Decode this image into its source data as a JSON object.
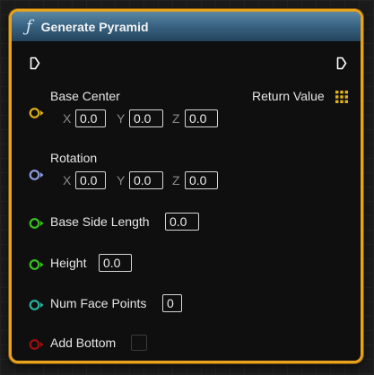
{
  "node": {
    "title": "Generate Pyramid",
    "function_icon": "function-icon",
    "accent_color": "#e8a21c",
    "header_color": "#3a6584"
  },
  "pins": {
    "base_center": {
      "label": "Base Center",
      "x_label": "X",
      "x": "0.0",
      "y_label": "Y",
      "y": "0.0",
      "z_label": "Z",
      "z": "0.0",
      "color": "#e0b21a"
    },
    "rotation": {
      "label": "Rotation",
      "x_label": "X",
      "x": "0.0",
      "y_label": "Y",
      "y": "0.0",
      "z_label": "Z",
      "z": "0.0",
      "color": "#8f9de0"
    },
    "base_side_length": {
      "label": "Base Side Length",
      "value": "0.0",
      "color": "#39c41f"
    },
    "height": {
      "label": "Height",
      "value": "0.0",
      "color": "#39c41f"
    },
    "num_face_points": {
      "label": "Num Face Points",
      "value": "0",
      "color": "#29b5a0"
    },
    "add_bottom": {
      "label": "Add Bottom",
      "checked": false,
      "color": "#a01010"
    },
    "return_value": {
      "label": "Return Value",
      "icon": "array-grid-icon",
      "color": "#e0b21a"
    }
  }
}
